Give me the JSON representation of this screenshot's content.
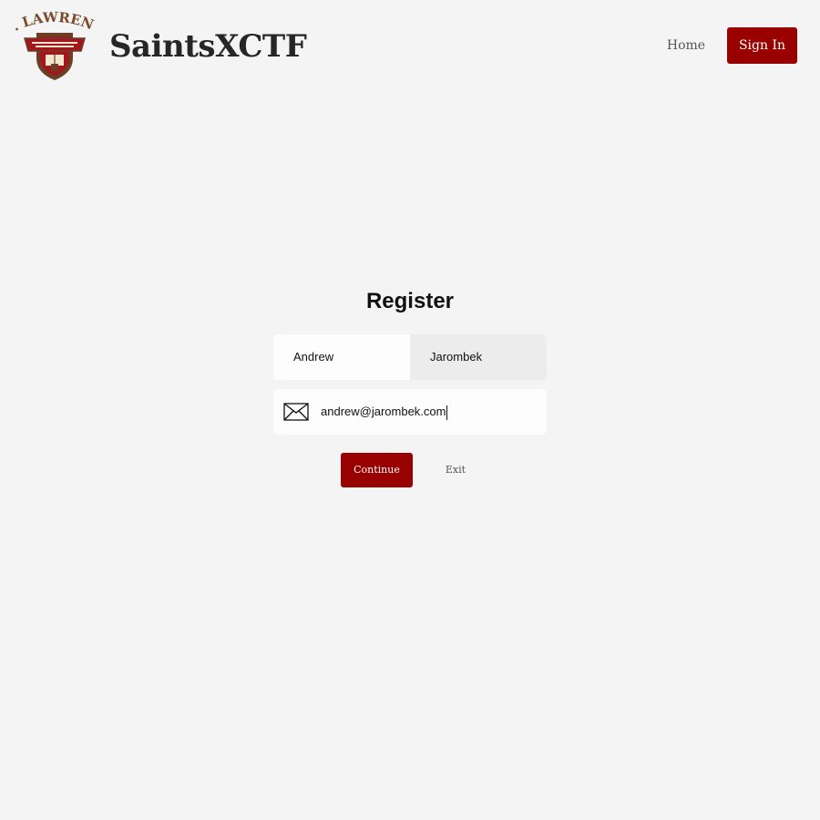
{
  "header": {
    "logo_text": "ST. LAWRENCE",
    "site_title": "SaintsXCTF",
    "nav": {
      "home_label": "Home",
      "signin_label": "Sign In"
    }
  },
  "register": {
    "title": "Register",
    "first_name_value": "Andrew",
    "last_name_value": "Jarombek",
    "email_value": "andrew@jarombek.com",
    "email_icon": "envelope-icon",
    "continue_label": "Continue",
    "exit_label": "Exit"
  },
  "colors": {
    "background": "#f4f4f4",
    "accent": "#990000",
    "logo_brown": "#7b4a2a"
  }
}
